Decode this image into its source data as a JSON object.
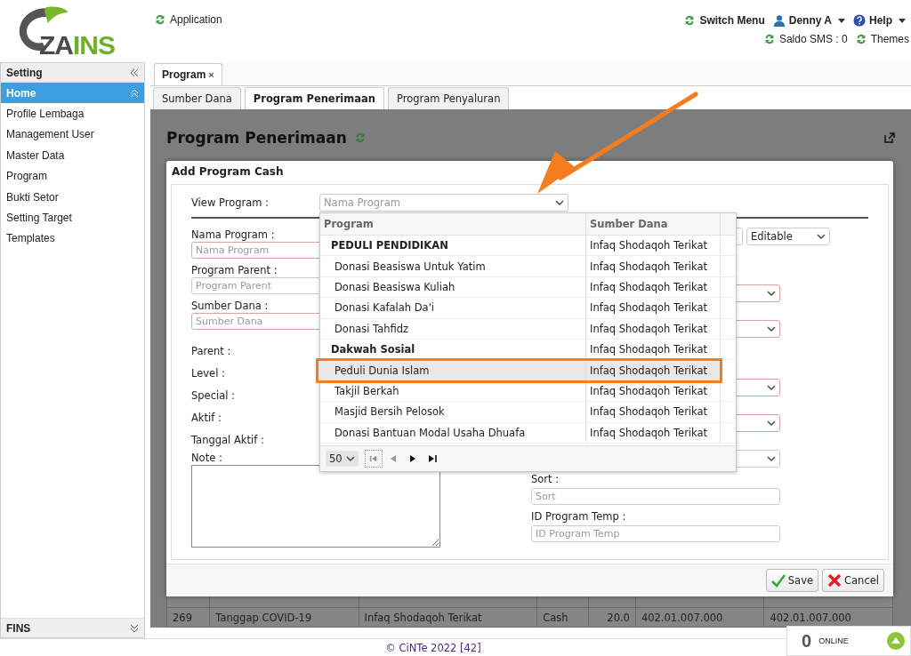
{
  "header": {
    "logo": {
      "dark": "ZA",
      "green": "INS"
    },
    "app_link": "Application",
    "menu": [
      {
        "kind": "refresh",
        "label": "Switch Menu"
      },
      {
        "kind": "user",
        "label": "Denny A"
      },
      {
        "kind": "help",
        "label": "Help"
      }
    ],
    "sms_balance": "Saldo SMS : 0",
    "themes": "Themes"
  },
  "sidebar": {
    "title": "Setting",
    "items": [
      {
        "label": "Home",
        "selected": true
      },
      {
        "label": "Profile Lembaga",
        "selected": false
      },
      {
        "label": "Management User",
        "selected": false
      },
      {
        "label": "Master Data",
        "selected": false
      },
      {
        "label": "Program",
        "selected": false
      },
      {
        "label": "Bukti Setor",
        "selected": false
      },
      {
        "label": "Setting Target",
        "selected": false
      },
      {
        "label": "Templates",
        "selected": false
      }
    ],
    "bottom_section": "FINS"
  },
  "tabs": [
    {
      "label": "Program",
      "close": "×"
    }
  ],
  "subtabs": [
    {
      "label": "Sumber Dana",
      "selected": false
    },
    {
      "label": "Program Penerimaan",
      "selected": true
    },
    {
      "label": "Program Penyaluran",
      "selected": false
    }
  ],
  "page_title": "Program Penerimaan",
  "background_table": {
    "rows": [
      [
        "269",
        "Tanggap COVID-19",
        "Infaq Shodaqoh Terikat",
        "Cash",
        "20.0",
        "402.01.007.000",
        "402.01.007.000"
      ]
    ]
  },
  "dialog": {
    "title": "Add Program Cash",
    "view_program": {
      "label": "View Program :",
      "placeholder": "Nama Program"
    },
    "left_fields": [
      {
        "kind": "input",
        "label": "Nama Program :",
        "placeholder": "Nama Program",
        "required": true
      },
      {
        "kind": "input",
        "label": "Program Parent :",
        "placeholder": "Program Parent",
        "required": false
      },
      {
        "kind": "input",
        "label": "Sumber Dana :",
        "placeholder": "Sumber Dana",
        "required": true
      },
      {
        "kind": "text",
        "label": "Parent :"
      },
      {
        "kind": "text",
        "label": "Level :"
      },
      {
        "kind": "text",
        "label": "Special :"
      },
      {
        "kind": "text",
        "label": "Aktif :"
      },
      {
        "kind": "text",
        "label": "Tanggal Aktif :"
      },
      {
        "kind": "textarea",
        "label": "Note :"
      }
    ],
    "right_fields": [
      {
        "kind": "input-select",
        "value": "Editable"
      },
      {
        "kind": "select",
        "required": true
      },
      {
        "kind": "select",
        "required": true
      },
      {
        "kind": "select",
        "required": true
      },
      {
        "kind": "select",
        "required": true
      },
      {
        "kind": "select",
        "required": false
      },
      {
        "kind": "input",
        "label": "Sort :",
        "placeholder": "Sort"
      },
      {
        "kind": "input",
        "label": "ID Program Temp :",
        "placeholder": "ID Program Temp"
      }
    ],
    "dropdown": {
      "columns": [
        "Program",
        "Sumber Dana"
      ],
      "rows": [
        {
          "program": "PEDULI PENDIDIKAN",
          "sumber_dana": "Infaq Shodaqoh Terikat",
          "group": true,
          "selected": false
        },
        {
          "program": "Donasi Beasiswa Untuk Yatim",
          "sumber_dana": "Infaq Shodaqoh Terikat",
          "group": false,
          "selected": false
        },
        {
          "program": "Donasi Beasiswa Kuliah",
          "sumber_dana": "Infaq Shodaqoh Terikat",
          "group": false,
          "selected": false
        },
        {
          "program": "Donasi Kafalah Da'i",
          "sumber_dana": "Infaq Shodaqoh Terikat",
          "group": false,
          "selected": false
        },
        {
          "program": "Donasi Tahfidz",
          "sumber_dana": "Infaq Shodaqoh Terikat",
          "group": false,
          "selected": false
        },
        {
          "program": "Dakwah Sosial",
          "sumber_dana": "Infaq Shodaqoh Terikat",
          "group": true,
          "selected": false
        },
        {
          "program": "Peduli Dunia Islam",
          "sumber_dana": "Infaq Shodaqoh Terikat",
          "group": false,
          "selected": true
        },
        {
          "program": "Takjil Berkah",
          "sumber_dana": "Infaq Shodaqoh Terikat",
          "group": false,
          "selected": false
        },
        {
          "program": "Masjid Bersih Pelosok",
          "sumber_dana": "Infaq Shodaqoh Terikat",
          "group": false,
          "selected": false
        },
        {
          "program": "Donasi Bantuan Modal Usaha Dhuafa",
          "sumber_dana": "Infaq Shodaqoh Terikat",
          "group": false,
          "selected": false
        }
      ],
      "page_size": "50"
    },
    "buttons": [
      {
        "kind": "save",
        "label": "Save"
      },
      {
        "kind": "cancel",
        "label": "Cancel"
      }
    ]
  },
  "footer": "© CiNTe 2022 [42]",
  "online": {
    "count": "0",
    "label": "ONLINE"
  }
}
